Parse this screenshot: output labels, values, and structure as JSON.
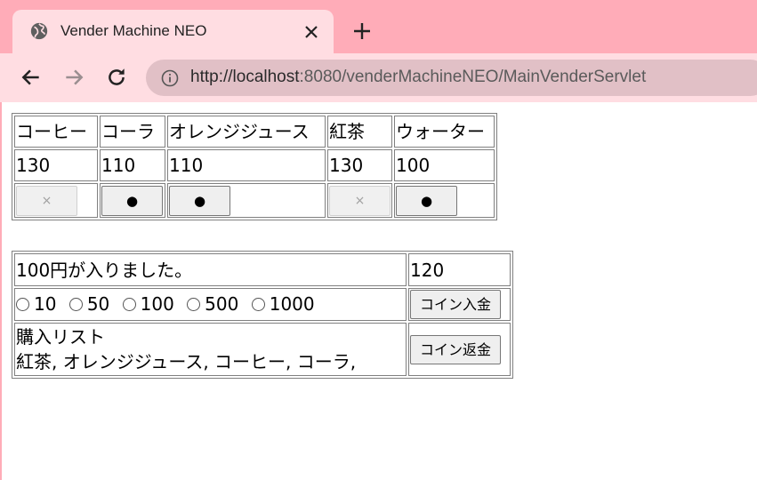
{
  "browser": {
    "tab_title": "Vender Machine NEO",
    "url_host": "http://localhost",
    "url_rest": ":8080/venderMachineNEO/MainVenderServlet",
    "colors": {
      "tabstrip": "#ffacb8",
      "tab_active": "#ffdde2",
      "omnibox": "#e1c0c6"
    }
  },
  "drinks": [
    {
      "name": "コーヒー",
      "price": "130",
      "button": "×",
      "available": false
    },
    {
      "name": "コーラ",
      "price": "110",
      "button": "●",
      "available": true
    },
    {
      "name": "オレンジジュース",
      "price": "110",
      "button": "●",
      "available": true
    },
    {
      "name": "紅茶",
      "price": "130",
      "button": "×",
      "available": false
    },
    {
      "name": "ウォーター",
      "price": "100",
      "button": "●",
      "available": true
    }
  ],
  "wallet": {
    "message": "100円が入りました。",
    "balance": "120",
    "coin_options": [
      "10",
      "50",
      "100",
      "500",
      "1000"
    ],
    "insert_button": "コイン入金",
    "purchase_list_label": "購入リスト",
    "purchase_list": "紅茶, オレンジジュース, コーヒー, コーラ,",
    "return_button": "コイン返金"
  }
}
